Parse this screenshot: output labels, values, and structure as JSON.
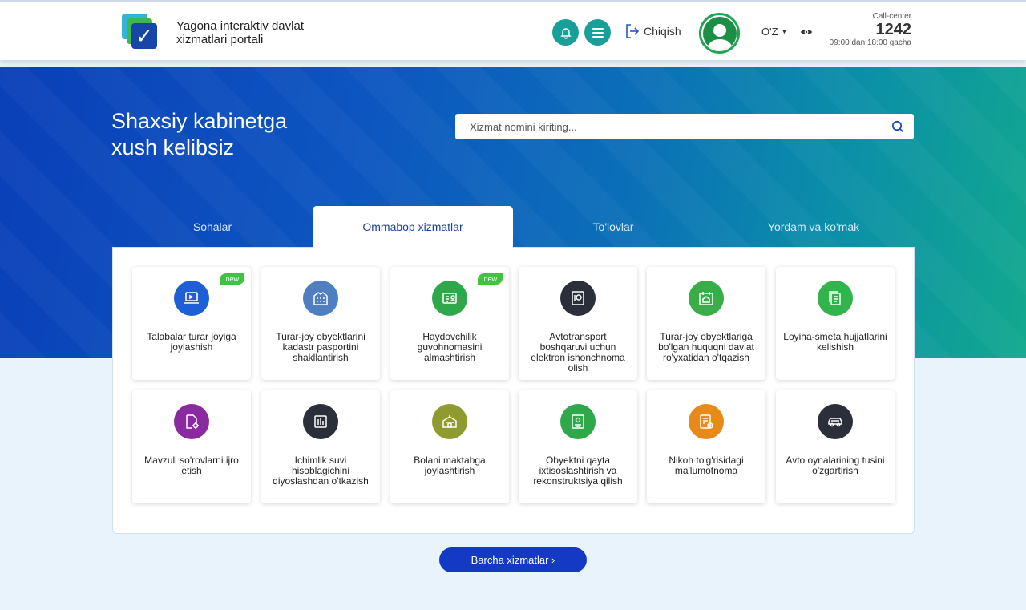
{
  "header": {
    "portal_title": "Yagona interaktiv davlat xizmatlari portali",
    "logout_label": "Chiqish",
    "language": "O'Z",
    "call_center": {
      "label": "Call-center",
      "number": "1242",
      "hours": "09:00 dan 18:00 gacha"
    }
  },
  "banner": {
    "welcome": "Shaxsiy kabinetga xush kelibsiz",
    "search_placeholder": "Xizmat nomini kiriting..."
  },
  "tabs": [
    {
      "label": "Sohalar",
      "active": false
    },
    {
      "label": "Ommabop xizmatlar",
      "active": true
    },
    {
      "label": "To'lovlar",
      "active": false
    },
    {
      "label": "Yordam va ko'mak",
      "active": false
    }
  ],
  "services": [
    {
      "label": "Talabalar turar joyiga joylashish",
      "icon": "laptop-icon",
      "color": "#1e5fd8",
      "badge": "new"
    },
    {
      "label": "Turar-joy obyektlarini kadastr pasportini shakllantirish",
      "icon": "building-icon",
      "color": "#4f7fc0",
      "badge": ""
    },
    {
      "label": "Haydovchilik guvohnomasini almashtirish",
      "icon": "license-icon",
      "color": "#2ea84a",
      "badge": "new"
    },
    {
      "label": "Avtotransport boshqaruvi uchun elektron ishonchnoma olish",
      "icon": "document-seal-icon",
      "color": "#2a2f3a",
      "badge": ""
    },
    {
      "label": "Turar-joy obyektlariga bo'lgan huquqni davlat ro'yxatidan o'tqazish",
      "icon": "house-calendar-icon",
      "color": "#3aac48",
      "badge": ""
    },
    {
      "label": "Loyiha-smeta hujjatlarini kelishish",
      "icon": "documents-icon",
      "color": "#33b34b",
      "badge": ""
    },
    {
      "label": "Mavzuli so'rovlarni ijro etish",
      "icon": "document-gear-icon",
      "color": "#8a2aa0",
      "badge": ""
    },
    {
      "label": "Ichimlik suvi hisoblagichini qiyoslashdan o'tkazish",
      "icon": "water-meter-icon",
      "color": "#2a2f3a",
      "badge": ""
    },
    {
      "label": "Bolani maktabga joylashtirish",
      "icon": "school-icon",
      "color": "#8f9a2f",
      "badge": ""
    },
    {
      "label": "Obyektni qayta ixtisoslashtirish va rekonstruktsiya qilish",
      "icon": "certificate-icon",
      "color": "#2ea84a",
      "badge": ""
    },
    {
      "label": "Nikoh to'g'risidagi ma'lumotnoma",
      "icon": "certificate-check-icon",
      "color": "#e88a1a",
      "badge": ""
    },
    {
      "label": "Avto oynalarining tusini o'zgartirish",
      "icon": "car-icon",
      "color": "#2a2f3a",
      "badge": ""
    }
  ],
  "all_services_label": "Barcha xizmatlar ›",
  "colors": {
    "accent": "#17a09a",
    "primary_button": "#1439c5",
    "tab_active_text": "#1a3f9e",
    "new_badge": "#3fc43f"
  }
}
